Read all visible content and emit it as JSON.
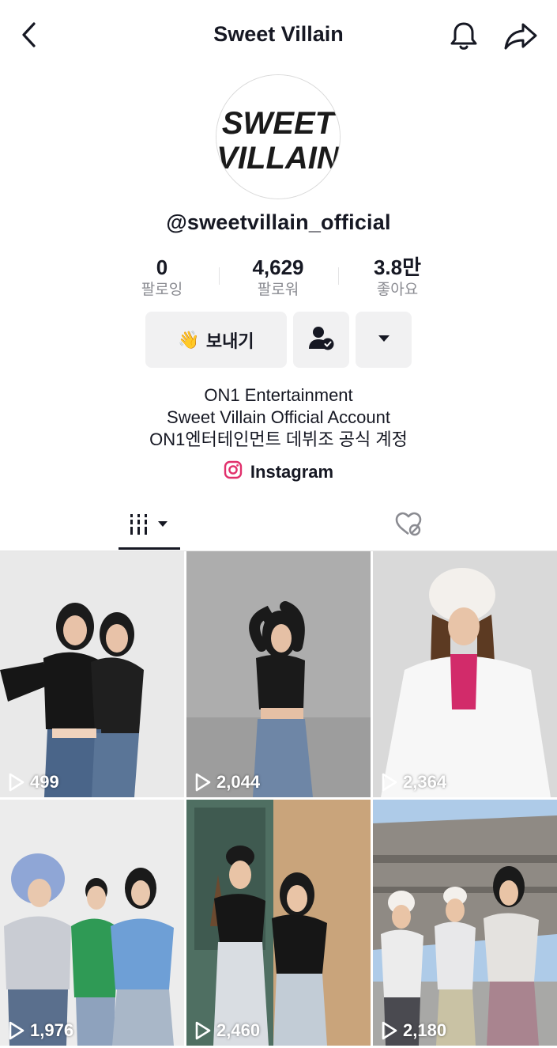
{
  "header": {
    "title": "Sweet Villain",
    "back_icon": "chevron-left-icon",
    "bell_icon": "bell-icon",
    "share_icon": "share-arrow-icon"
  },
  "avatar": {
    "line1": "SWEET",
    "line2": "VILLAIN"
  },
  "profile": {
    "username": "@sweetvillain_official",
    "stats": [
      {
        "value": "0",
        "label": "팔로잉"
      },
      {
        "value": "4,629",
        "label": "팔로워"
      },
      {
        "value": "3.8만",
        "label": "좋아요"
      }
    ]
  },
  "actions": {
    "send_emoji": "👋",
    "send_label": "보내기",
    "follow_icon": "user-check-icon",
    "more_icon": "caret-down-icon"
  },
  "bio": {
    "lines": [
      "ON1 Entertainment",
      "Sweet Villain Official Account",
      "ON1엔터테인먼트 데뷔조 공식 계정"
    ],
    "link_label": "Instagram"
  },
  "tabs": {
    "videos_icon": "grid-bars-icon",
    "liked_icon": "hidden-heart-icon"
  },
  "videos": [
    {
      "views": "499"
    },
    {
      "views": "2,044"
    },
    {
      "views": "2,364"
    },
    {
      "views": "1,976"
    },
    {
      "views": "2,460"
    },
    {
      "views": "2,180"
    }
  ]
}
